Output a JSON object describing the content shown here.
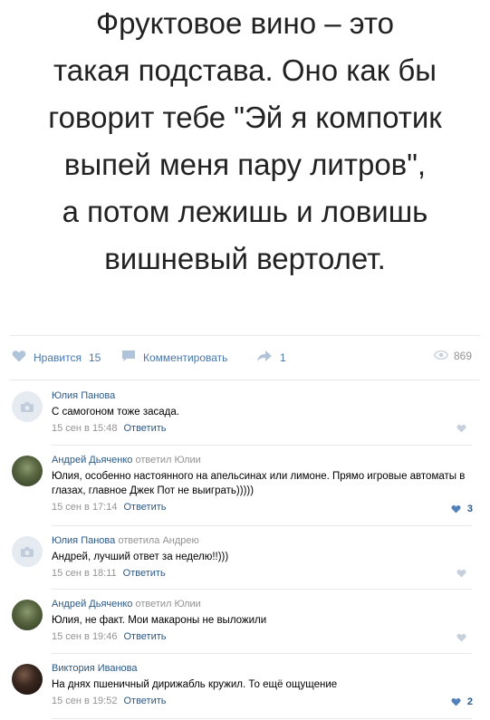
{
  "post": {
    "lines": [
      "Фруктовое вино – это",
      "такая подстава. Оно как бы",
      "говорит тебе \"Эй я компотик",
      "выпей меня пару литров\",",
      "а потом лежишь и ловишь",
      "вишневый вертолет."
    ]
  },
  "actions": {
    "like_label": "Нравится",
    "like_count": "15",
    "comment_label": "Комментировать",
    "share_count": "1",
    "views_count": "869"
  },
  "comments": [
    {
      "author": "Юлия Панова",
      "reply_to": "",
      "text": "С самогоном тоже засада.",
      "date": "15 сен в 15:48",
      "reply_label": "Ответить",
      "likes": ""
    },
    {
      "author": "Андрей Дьяченко",
      "reply_to": "ответил Юлии",
      "text": "Юлия, особенно настоянного на апельсинах или лимоне. Прямо игровые автоматы в глазах, главное Джек Пот не выиграть)))))",
      "date": "15 сен в 17:14",
      "reply_label": "Ответить",
      "likes": "3"
    },
    {
      "author": "Юлия Панова",
      "reply_to": "ответила Андрею",
      "text": "Андрей, лучший ответ за неделю!!)))",
      "date": "15 сен в 18:11",
      "reply_label": "Ответить",
      "likes": ""
    },
    {
      "author": "Андрей Дьяченко",
      "reply_to": "ответил Юлии",
      "text": "Юлия, не факт. Мои макароны не выложили",
      "date": "15 сен в 19:46",
      "reply_label": "Ответить",
      "likes": ""
    },
    {
      "author": "Виктория Иванова",
      "reply_to": "",
      "text": "На днях пшеничный дирижабль кружил. То ещё ощущение",
      "date": "15 сен в 19:52",
      "reply_label": "Ответить",
      "likes": "2"
    }
  ]
}
